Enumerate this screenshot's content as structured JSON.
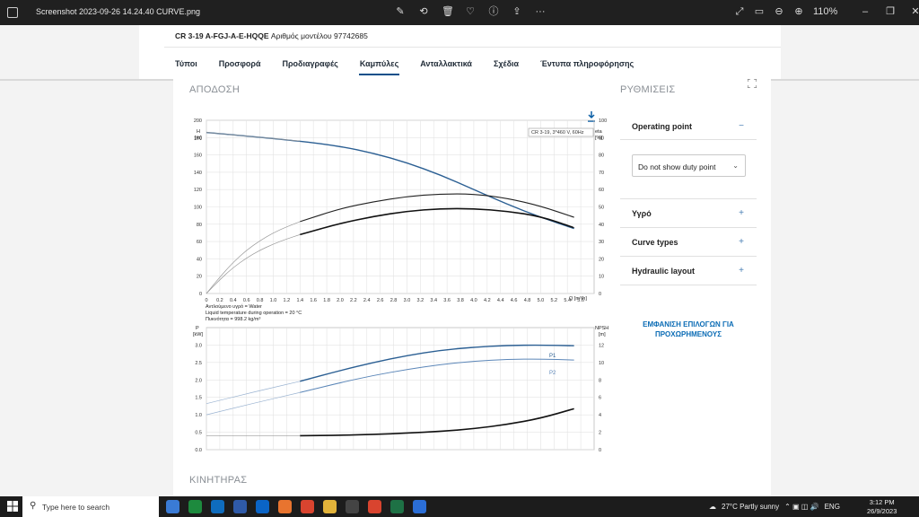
{
  "viewer": {
    "filename": "Screenshot 2023-09-26 14.24.40 CURVE.png",
    "zoom": "110%"
  },
  "product": {
    "model": "CR 3-19 A-FGJ-A-E-HQQE",
    "model_number_label": "Αριθμός μοντέλου 97742685"
  },
  "nav": {
    "tabs": [
      "Τύποι",
      "Προσφορά",
      "Προδιαγραφές",
      "Καμπύλες",
      "Ανταλλακτικά",
      "Σχέδια",
      "Έντυπα πληροφόρησης"
    ],
    "active_index": 3
  },
  "sections": {
    "performance": "ΑΠΟΔΟΣΗ",
    "settings": "ΡΥΘΜΙΣΕΙΣ",
    "motor": "ΚΙΝΗΤΗΡΑΣ"
  },
  "settings": {
    "operating_point": "Operating point",
    "duty_point_select": "Do not show duty point",
    "liquid": "Υγρό",
    "curve_types": "Curve types",
    "hydraulic_layout": "Hydraulic layout",
    "advanced_options_line1": "ΕΜΦΑΝΙΣΗ ΕΠΙΛΟΓΩΝ ΓΙΑ",
    "advanced_options_line2": "ΠΡΟΧΩΡΗΜΕΝΟΥΣ",
    "minus_symbol": "−",
    "plus_symbol": "+"
  },
  "chart_info": {
    "legend_box": "CR 3-19, 3*460 V, 60Hz",
    "note1": "Αντλούμενο υγρό = Water",
    "note2": "Liquid temperature during operation = 20 °C",
    "note3": "Πυκνότητα = 998.2 kg/m³",
    "h_label": "H",
    "h_unit": "[m]",
    "eta_label": "eta",
    "eta_unit": "[%]",
    "q_label": "Q [m³/h]",
    "p_label": "P",
    "p_unit": "[kW]",
    "npsh_label": "NPSH",
    "npsh_unit": "[m]",
    "p1_label": "P1",
    "p2_label": "P2"
  },
  "chart_data": [
    {
      "type": "line",
      "xlabel": "Q [m³/h]",
      "ylabel": "H [m]",
      "y2label": "eta [%]",
      "xlim": [
        0,
        5.8
      ],
      "ylim": [
        0,
        200
      ],
      "y2lim": [
        0,
        100
      ],
      "x_ticks": [
        0,
        0.2,
        0.4,
        0.6,
        0.8,
        1.0,
        1.2,
        1.4,
        1.6,
        1.8,
        2.0,
        2.2,
        2.4,
        2.6,
        2.8,
        3.0,
        3.2,
        3.4,
        3.6,
        3.8,
        4.0,
        4.2,
        4.4,
        4.6,
        4.8,
        5.0,
        5.2,
        5.4,
        5.6
      ],
      "y_ticks": [
        0,
        20,
        40,
        60,
        80,
        100,
        120,
        140,
        160,
        180,
        200
      ],
      "y2_ticks": [
        0,
        10,
        20,
        30,
        40,
        50,
        60,
        70,
        80,
        90,
        100
      ],
      "grid": true,
      "series": [
        {
          "axis": "left",
          "color": "#2b5f93",
          "width": 1.4,
          "x": [
            0,
            1.4,
            2.0,
            2.5,
            3.0,
            3.5,
            4.0,
            4.5,
            5.0,
            5.5
          ],
          "values": [
            186,
            176,
            170,
            162,
            151,
            137,
            120,
            103,
            88,
            75
          ]
        },
        {
          "axis": "left",
          "color": "#222222",
          "width": 1.1,
          "x": [
            1.4,
            2.0,
            2.5,
            3.0,
            3.5,
            4.0,
            4.5,
            5.0,
            5.5
          ],
          "values": [
            83,
            98,
            106,
            112,
            115,
            115,
            110,
            101,
            88
          ]
        },
        {
          "axis": "left",
          "color": "#111111",
          "width": 1.6,
          "x": [
            1.4,
            2.0,
            2.5,
            3.0,
            3.5,
            4.0,
            4.5,
            5.0,
            5.5
          ],
          "values": [
            68,
            81,
            89,
            95,
            98,
            98,
            95,
            89,
            76
          ]
        },
        {
          "axis": "left",
          "color": "#9a9a9a",
          "width": 0.7,
          "x": [
            0,
            0.2,
            0.4,
            0.6,
            0.8,
            1.0,
            1.2,
            1.4
          ],
          "values": [
            0,
            19,
            36,
            50,
            61,
            70,
            77,
            83
          ]
        },
        {
          "axis": "left",
          "color": "#9a9a9a",
          "width": 0.7,
          "x": [
            0,
            0.2,
            0.4,
            0.6,
            0.8,
            1.0,
            1.2,
            1.4
          ],
          "values": [
            0,
            16,
            30,
            41,
            50,
            57,
            63,
            68
          ]
        },
        {
          "axis": "left",
          "color": "#9a9a9a",
          "width": 0.7,
          "x": [
            0,
            1.4
          ],
          "values": [
            186,
            176
          ]
        }
      ]
    },
    {
      "type": "line",
      "xlabel": "",
      "ylabel": "P [kW]",
      "y2label": "NPSH [m]",
      "xlim": [
        0,
        5.8
      ],
      "ylim": [
        0,
        3.5
      ],
      "y2lim": [
        0,
        14
      ],
      "y_ticks": [
        0.0,
        0.5,
        1.0,
        1.5,
        2.0,
        2.5,
        3.0
      ],
      "y2_ticks": [
        0,
        2,
        4,
        6,
        8,
        10,
        12
      ],
      "grid": true,
      "series": [
        {
          "name": "P1",
          "axis": "left",
          "color": "#2b5f93",
          "width": 1.4,
          "x": [
            1.4,
            2.0,
            2.5,
            3.0,
            3.5,
            4.0,
            4.5,
            5.0,
            5.5
          ],
          "values": [
            1.96,
            2.27,
            2.5,
            2.7,
            2.85,
            2.94,
            2.99,
            3.0,
            2.98
          ]
        },
        {
          "name": "P2",
          "axis": "left",
          "color": "#5b86b8",
          "width": 1.0,
          "x": [
            1.4,
            2.0,
            2.5,
            3.0,
            3.5,
            4.0,
            4.5,
            5.0,
            5.5
          ],
          "values": [
            1.64,
            1.92,
            2.13,
            2.3,
            2.44,
            2.54,
            2.59,
            2.6,
            2.57
          ]
        },
        {
          "axis": "left",
          "color": "#9ab3d1",
          "width": 0.7,
          "x": [
            0,
            0.7,
            1.4
          ],
          "values": [
            1.32,
            1.65,
            1.96
          ]
        },
        {
          "axis": "left",
          "color": "#9ab3d1",
          "width": 0.7,
          "x": [
            0,
            0.7,
            1.4
          ],
          "values": [
            1.0,
            1.33,
            1.64
          ]
        },
        {
          "axis": "right",
          "color": "#111111",
          "width": 1.6,
          "x": [
            1.4,
            2.0,
            2.5,
            3.0,
            3.5,
            4.0,
            4.5,
            5.0,
            5.5
          ],
          "values": [
            1.6,
            1.65,
            1.75,
            1.9,
            2.1,
            2.4,
            2.9,
            3.6,
            4.7
          ]
        },
        {
          "axis": "right",
          "color": "#9a9a9a",
          "width": 0.7,
          "x": [
            0,
            1.4
          ],
          "values": [
            1.6,
            1.6
          ]
        }
      ]
    }
  ],
  "taskbar": {
    "search_placeholder": "Type here to search",
    "weather": "27°C  Partly sunny",
    "lang": "ENG",
    "time": "3:12 PM",
    "date": "26/9/2023"
  }
}
